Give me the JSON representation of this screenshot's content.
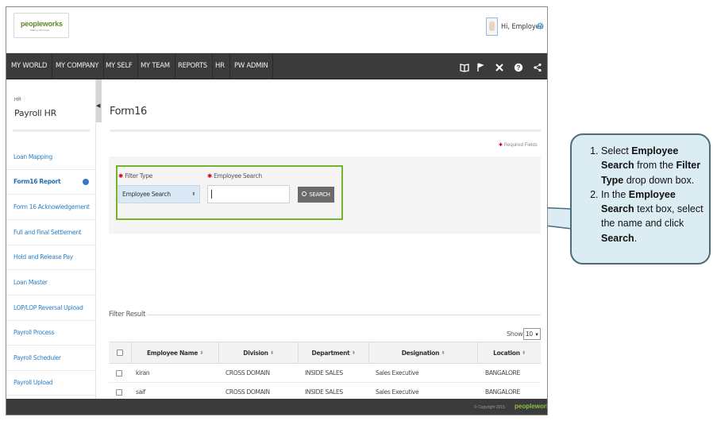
{
  "header": {
    "logo_text": "peopleworks",
    "logo_tagline": "Making HR simple",
    "greeting": "Hi, Employee"
  },
  "nav": {
    "items": [
      "MY WORLD",
      "MY COMPANY",
      "MY SELF",
      "MY TEAM",
      "REPORTS",
      "HR",
      "PW ADMIN"
    ],
    "icons": [
      "book-icon",
      "flag-icon",
      "tools-icon",
      "help-icon",
      "share-icon"
    ]
  },
  "sidebar": {
    "section": "HR",
    "title": "Payroll HR",
    "items": [
      {
        "label": "Loan Mapping"
      },
      {
        "label": "Form16 Report",
        "active": true
      },
      {
        "label": "Form 16 Acknowledgement"
      },
      {
        "label": "Full and Final Settlement"
      },
      {
        "label": "Hold and Release Pay"
      },
      {
        "label": "Loan Master"
      },
      {
        "label": "LOP/LOP Reversal Upload"
      },
      {
        "label": "Payroll Process"
      },
      {
        "label": "Payroll Scheduler"
      },
      {
        "label": "Payroll Upload"
      }
    ]
  },
  "main": {
    "page_title": "Form16",
    "required_note": "Required Fields",
    "filter": {
      "filter_type_label": "Filter Type",
      "filter_type_value": "Employee Search",
      "employee_search_label": "Employee Search",
      "employee_search_value": "",
      "search_button": "SEARCH"
    },
    "filter_result_label": "Filter Result",
    "show_label": "Show:",
    "show_value": "10",
    "table": {
      "columns": [
        "",
        "Employee Name",
        "Division",
        "Department",
        "Designation",
        "Location"
      ],
      "rows": [
        [
          "",
          "kiran",
          "CROSS DOMAIN",
          "INSIDE SALES",
          "Sales Executive",
          "BANGALORE"
        ],
        [
          "",
          "saif",
          "CROSS DOMAIN",
          "INSIDE SALES",
          "Sales Executive",
          "BANGALORE"
        ]
      ]
    }
  },
  "footer": {
    "copyright": "© Copyright 2015",
    "logo_text": "peopleworks"
  },
  "callout": {
    "step1_pre": "Select ",
    "step1_b1": "Employee Search",
    "step1_mid": " from the ",
    "step1_b2": "Filter Type",
    "step1_post": " drop down box.",
    "step2_pre": "In the ",
    "step2_b1": "Employee Search",
    "step2_mid": " text box, select the name and click ",
    "step2_b2": "Search",
    "step2_post": "."
  },
  "colors": {
    "nav_bg": "#3b3b3b",
    "highlight_border": "#74b32e",
    "link_blue": "#2a7ec4",
    "callout_bg": "#dcecf3",
    "callout_border": "#4e6b7a"
  }
}
